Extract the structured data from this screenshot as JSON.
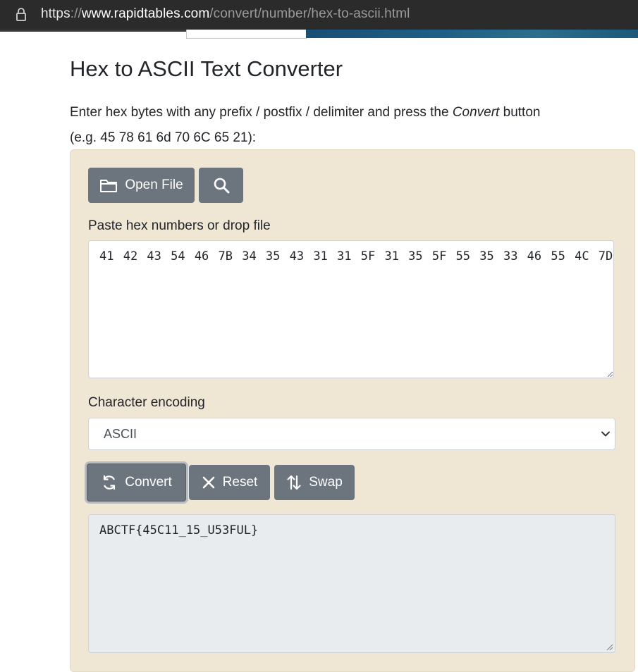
{
  "browser": {
    "url_protocol": "https",
    "url_separator": "://",
    "url_host": "www.rapidtables.com",
    "url_path": "/convert/number/hex-to-ascii.html"
  },
  "page": {
    "title": "Hex to ASCII Text Converter",
    "intro_part1": "Enter hex bytes with any prefix / postfix / delimiter and press the ",
    "intro_italic": "Convert",
    "intro_part2": " button",
    "intro_example": "(e.g. 45 78 61 6d 70 6C 65 21):"
  },
  "toolbar": {
    "open_file_label": "Open File",
    "search_icon": "search-icon",
    "folder_icon": "folder-icon"
  },
  "input": {
    "label": "Paste hex numbers or drop file",
    "value": "41 42 43 54 46 7B 34 35 43 31 31 5F 31 35 5F 55 35 33 46 55 4C 7D"
  },
  "encoding": {
    "label": "Character encoding",
    "selected": "ASCII"
  },
  "actions": {
    "convert_label": "Convert",
    "reset_label": "Reset",
    "swap_label": "Swap"
  },
  "output": {
    "value": "ABCTF{45C11_15_U53FUL}"
  },
  "colors": {
    "button_bg": "#6c757d",
    "panel_bg": "#efe6d4",
    "output_bg": "#e9ecef",
    "address_bar_bg": "#2b2b2b"
  }
}
